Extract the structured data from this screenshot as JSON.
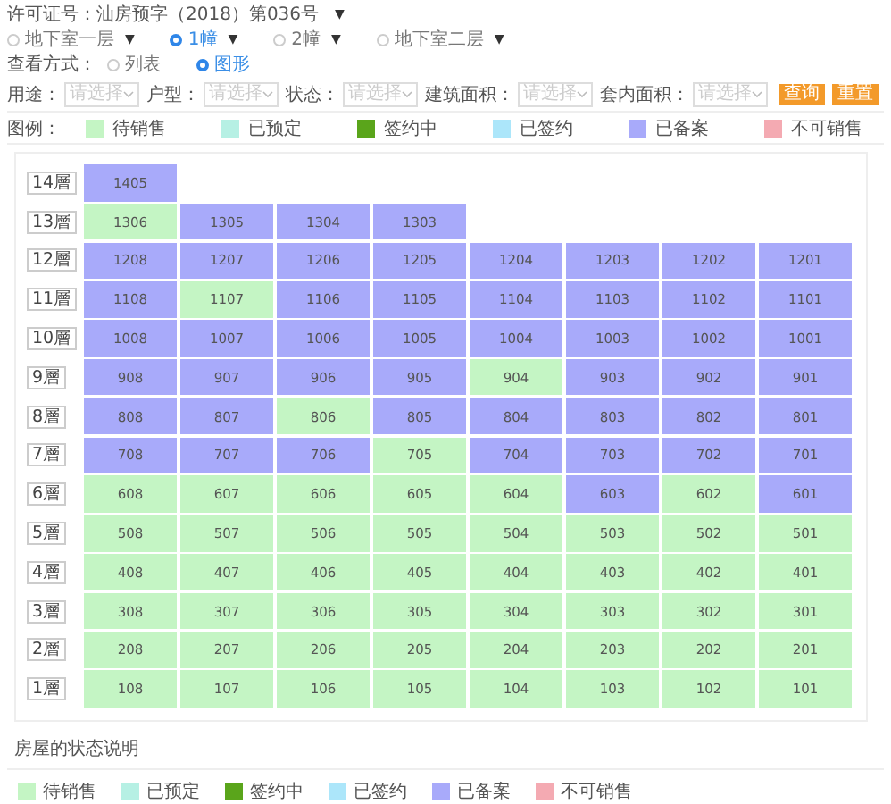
{
  "permit": {
    "label": "许可证号：汕房预字（2018）第036号",
    "caret": "▼"
  },
  "buildings": [
    {
      "label": "地下室一层",
      "caret": "▼",
      "selected": false
    },
    {
      "label": "1幢",
      "caret": "▼",
      "selected": true
    },
    {
      "label": "2幢",
      "caret": "▼",
      "selected": false
    },
    {
      "label": "地下室二层",
      "caret": "▼",
      "selected": false
    }
  ],
  "view_mode": {
    "label": "查看方式：",
    "options": [
      {
        "label": "列表",
        "selected": false
      },
      {
        "label": "图形",
        "selected": true
      }
    ]
  },
  "filters": [
    {
      "label": "用途：",
      "placeholder": "请选择"
    },
    {
      "label": "户型：",
      "placeholder": "请选择"
    },
    {
      "label": "状态：",
      "placeholder": "请选择"
    },
    {
      "label": "建筑面积：",
      "placeholder": "请选择"
    },
    {
      "label": "套内面积：",
      "placeholder": "请选择"
    }
  ],
  "buttons": [
    "查询",
    "重置"
  ],
  "legend": {
    "label": "图例：",
    "items": [
      {
        "label": "待销售",
        "color": "#c4f5c4"
      },
      {
        "label": "已预定",
        "color": "#b6f0e4"
      },
      {
        "label": "签约中",
        "color": "#5aa51b"
      },
      {
        "label": "已签约",
        "color": "#ace6fa"
      },
      {
        "label": "已备案",
        "color": "#a8aafa"
      },
      {
        "label": "不可销售",
        "color": "#f4aab2"
      }
    ]
  },
  "floors": [
    {
      "label": "14層",
      "units": [
        {
          "no": "1405",
          "color": "#a8aafa"
        }
      ]
    },
    {
      "label": "13層",
      "units": [
        {
          "no": "1306",
          "color": "#c4f5c4"
        },
        {
          "no": "1305",
          "color": "#a8aafa"
        },
        {
          "no": "1304",
          "color": "#a8aafa"
        },
        {
          "no": "1303",
          "color": "#a8aafa"
        }
      ]
    },
    {
      "label": "12層",
      "units": [
        {
          "no": "1208",
          "color": "#a8aafa"
        },
        {
          "no": "1207",
          "color": "#a8aafa"
        },
        {
          "no": "1206",
          "color": "#a8aafa"
        },
        {
          "no": "1205",
          "color": "#a8aafa"
        },
        {
          "no": "1204",
          "color": "#a8aafa"
        },
        {
          "no": "1203",
          "color": "#a8aafa"
        },
        {
          "no": "1202",
          "color": "#a8aafa"
        },
        {
          "no": "1201",
          "color": "#a8aafa"
        }
      ]
    },
    {
      "label": "11層",
      "units": [
        {
          "no": "1108",
          "color": "#a8aafa"
        },
        {
          "no": "1107",
          "color": "#c4f5c4"
        },
        {
          "no": "1106",
          "color": "#a8aafa"
        },
        {
          "no": "1105",
          "color": "#a8aafa"
        },
        {
          "no": "1104",
          "color": "#a8aafa"
        },
        {
          "no": "1103",
          "color": "#a8aafa"
        },
        {
          "no": "1102",
          "color": "#a8aafa"
        },
        {
          "no": "1101",
          "color": "#a8aafa"
        }
      ]
    },
    {
      "label": "10層",
      "units": [
        {
          "no": "1008",
          "color": "#a8aafa"
        },
        {
          "no": "1007",
          "color": "#a8aafa"
        },
        {
          "no": "1006",
          "color": "#a8aafa"
        },
        {
          "no": "1005",
          "color": "#a8aafa"
        },
        {
          "no": "1004",
          "color": "#a8aafa"
        },
        {
          "no": "1003",
          "color": "#a8aafa"
        },
        {
          "no": "1002",
          "color": "#a8aafa"
        },
        {
          "no": "1001",
          "color": "#a8aafa"
        }
      ]
    },
    {
      "label": "9層",
      "units": [
        {
          "no": "908",
          "color": "#a8aafa"
        },
        {
          "no": "907",
          "color": "#a8aafa"
        },
        {
          "no": "906",
          "color": "#a8aafa"
        },
        {
          "no": "905",
          "color": "#a8aafa"
        },
        {
          "no": "904",
          "color": "#c4f5c4"
        },
        {
          "no": "903",
          "color": "#a8aafa"
        },
        {
          "no": "902",
          "color": "#a8aafa"
        },
        {
          "no": "901",
          "color": "#a8aafa"
        }
      ]
    },
    {
      "label": "8層",
      "units": [
        {
          "no": "808",
          "color": "#a8aafa"
        },
        {
          "no": "807",
          "color": "#a8aafa"
        },
        {
          "no": "806",
          "color": "#c4f5c4"
        },
        {
          "no": "805",
          "color": "#a8aafa"
        },
        {
          "no": "804",
          "color": "#a8aafa"
        },
        {
          "no": "803",
          "color": "#a8aafa"
        },
        {
          "no": "802",
          "color": "#a8aafa"
        },
        {
          "no": "801",
          "color": "#a8aafa"
        }
      ]
    },
    {
      "label": "7層",
      "units": [
        {
          "no": "708",
          "color": "#a8aafa"
        },
        {
          "no": "707",
          "color": "#a8aafa"
        },
        {
          "no": "706",
          "color": "#a8aafa"
        },
        {
          "no": "705",
          "color": "#c4f5c4"
        },
        {
          "no": "704",
          "color": "#a8aafa"
        },
        {
          "no": "703",
          "color": "#a8aafa"
        },
        {
          "no": "702",
          "color": "#a8aafa"
        },
        {
          "no": "701",
          "color": "#a8aafa"
        }
      ]
    },
    {
      "label": "6層",
      "units": [
        {
          "no": "608",
          "color": "#c4f5c4"
        },
        {
          "no": "607",
          "color": "#c4f5c4"
        },
        {
          "no": "606",
          "color": "#c4f5c4"
        },
        {
          "no": "605",
          "color": "#c4f5c4"
        },
        {
          "no": "604",
          "color": "#c4f5c4"
        },
        {
          "no": "603",
          "color": "#a8aafa"
        },
        {
          "no": "602",
          "color": "#c4f5c4"
        },
        {
          "no": "601",
          "color": "#a8aafa"
        }
      ]
    },
    {
      "label": "5層",
      "units": [
        {
          "no": "508",
          "color": "#c4f5c4"
        },
        {
          "no": "507",
          "color": "#c4f5c4"
        },
        {
          "no": "506",
          "color": "#c4f5c4"
        },
        {
          "no": "505",
          "color": "#c4f5c4"
        },
        {
          "no": "504",
          "color": "#c4f5c4"
        },
        {
          "no": "503",
          "color": "#c4f5c4"
        },
        {
          "no": "502",
          "color": "#c4f5c4"
        },
        {
          "no": "501",
          "color": "#c4f5c4"
        }
      ]
    },
    {
      "label": "4層",
      "units": [
        {
          "no": "408",
          "color": "#c4f5c4"
        },
        {
          "no": "407",
          "color": "#c4f5c4"
        },
        {
          "no": "406",
          "color": "#c4f5c4"
        },
        {
          "no": "405",
          "color": "#c4f5c4"
        },
        {
          "no": "404",
          "color": "#c4f5c4"
        },
        {
          "no": "403",
          "color": "#c4f5c4"
        },
        {
          "no": "402",
          "color": "#c4f5c4"
        },
        {
          "no": "401",
          "color": "#c4f5c4"
        }
      ]
    },
    {
      "label": "3層",
      "units": [
        {
          "no": "308",
          "color": "#c4f5c4"
        },
        {
          "no": "307",
          "color": "#c4f5c4"
        },
        {
          "no": "306",
          "color": "#c4f5c4"
        },
        {
          "no": "305",
          "color": "#c4f5c4"
        },
        {
          "no": "304",
          "color": "#c4f5c4"
        },
        {
          "no": "303",
          "color": "#c4f5c4"
        },
        {
          "no": "302",
          "color": "#c4f5c4"
        },
        {
          "no": "301",
          "color": "#c4f5c4"
        }
      ]
    },
    {
      "label": "2層",
      "units": [
        {
          "no": "208",
          "color": "#c4f5c4"
        },
        {
          "no": "207",
          "color": "#c4f5c4"
        },
        {
          "no": "206",
          "color": "#c4f5c4"
        },
        {
          "no": "205",
          "color": "#c4f5c4"
        },
        {
          "no": "204",
          "color": "#c4f5c4"
        },
        {
          "no": "203",
          "color": "#c4f5c4"
        },
        {
          "no": "202",
          "color": "#c4f5c4"
        },
        {
          "no": "201",
          "color": "#c4f5c4"
        }
      ]
    },
    {
      "label": "1層",
      "units": [
        {
          "no": "108",
          "color": "#c4f5c4"
        },
        {
          "no": "107",
          "color": "#c4f5c4"
        },
        {
          "no": "106",
          "color": "#c4f5c4"
        },
        {
          "no": "105",
          "color": "#c4f5c4"
        },
        {
          "no": "104",
          "color": "#c4f5c4"
        },
        {
          "no": "103",
          "color": "#c4f5c4"
        },
        {
          "no": "102",
          "color": "#c4f5c4"
        },
        {
          "no": "101",
          "color": "#c4f5c4"
        }
      ]
    }
  ],
  "status_legend": {
    "title": "房屋的状态说明",
    "items": [
      {
        "label": "待销售",
        "color": "#c4f5c4"
      },
      {
        "label": "已预定",
        "color": "#b6f0e4"
      },
      {
        "label": "签约中",
        "color": "#5aa51b"
      },
      {
        "label": "已签约",
        "color": "#ace6fa"
      },
      {
        "label": "已备案",
        "color": "#a8aafa"
      },
      {
        "label": "不可销售",
        "color": "#f4aab2"
      }
    ]
  }
}
